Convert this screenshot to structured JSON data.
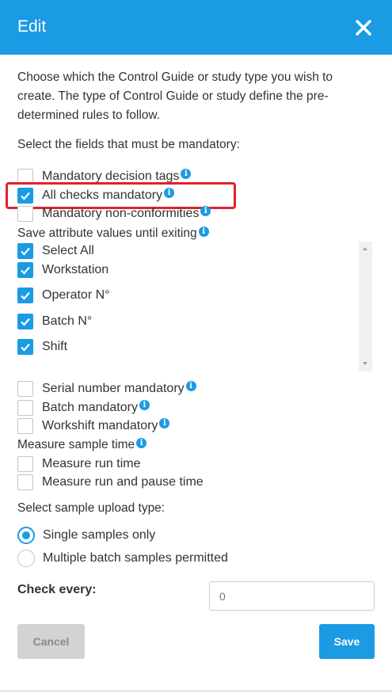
{
  "header": {
    "title": "Edit",
    "close_icon": "close-icon",
    "color": "#1a9be3"
  },
  "intro": "Choose which the Control Guide or study type you wish to create. The type of Control Guide or study define the pre-determined rules to follow.",
  "mandatory_section": {
    "label": "Select the fields that must be mandatory:",
    "items": [
      {
        "label": "Mandatory decision tags",
        "checked": false,
        "info": true
      },
      {
        "label": "All checks mandatory",
        "checked": true,
        "info": true,
        "highlighted": true
      },
      {
        "label": "Mandatory non-conformities",
        "checked": false,
        "info": true
      }
    ]
  },
  "save_attributes": {
    "label": "Save attribute values until exiting",
    "info": true,
    "items": [
      {
        "label": "Select All",
        "checked": true
      },
      {
        "label": "Workstation",
        "checked": true
      },
      {
        "label": "Operator N°",
        "checked": true
      },
      {
        "label": "Batch N°",
        "checked": true
      },
      {
        "label": "Shift",
        "checked": true
      }
    ]
  },
  "extra_mandatory": {
    "items": [
      {
        "label": "Serial number mandatory",
        "checked": false,
        "info": true
      },
      {
        "label": "Batch mandatory",
        "checked": false,
        "info": true
      },
      {
        "label": "Workshift mandatory",
        "checked": false,
        "info": true
      }
    ]
  },
  "measure_sample_time": {
    "label": "Measure sample time",
    "info": true,
    "items": [
      {
        "label": "Measure run time",
        "checked": false
      },
      {
        "label": "Measure run and pause time",
        "checked": false
      }
    ]
  },
  "upload_type": {
    "label": "Select sample upload type:",
    "options": [
      {
        "label": "Single samples only",
        "selected": true
      },
      {
        "label": "Multiple batch samples permitted",
        "selected": false
      }
    ]
  },
  "check_every": {
    "label": "Check every:",
    "placeholder": "0"
  },
  "buttons": {
    "cancel": "Cancel",
    "save": "Save"
  }
}
